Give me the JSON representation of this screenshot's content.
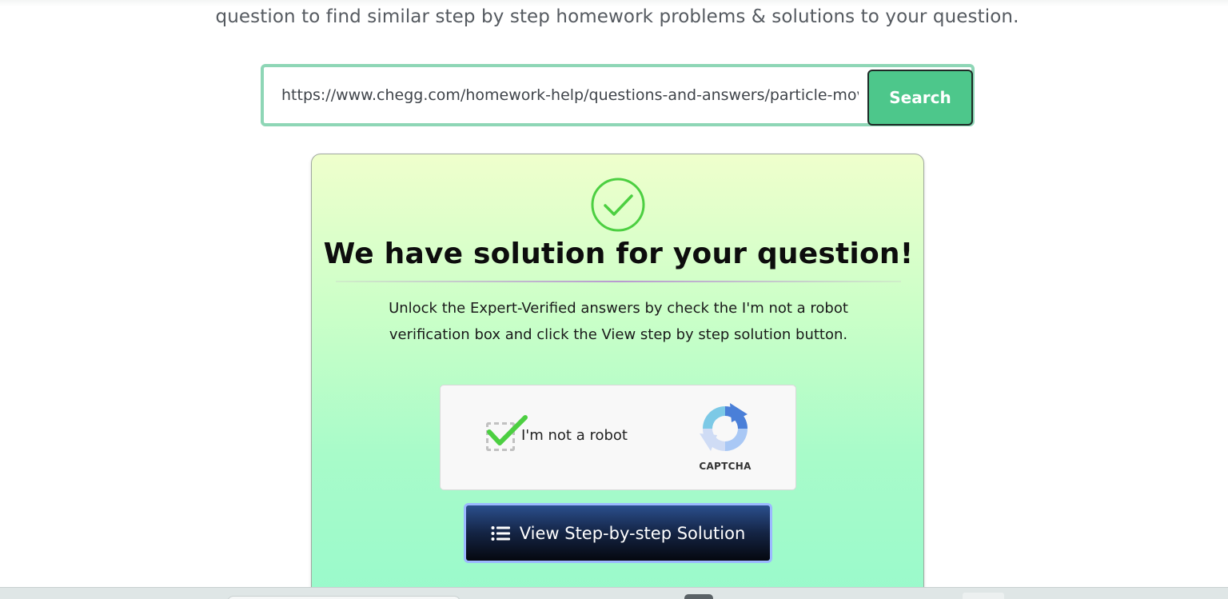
{
  "header": {
    "intro_text": "question to find similar step by step homework problems & solutions to your question."
  },
  "search": {
    "value": "https://www.chegg.com/homework-help/questions-and-answers/particle-movi",
    "button_label": "Search"
  },
  "result_card": {
    "title": "We have solution for your question!",
    "description": "Unlock the Expert-Verified answers by check the I'm not a robot verification box and click the View step by step solution button.",
    "captcha": {
      "checkbox_label": "I'm not a robot",
      "checked": true,
      "brand_label": "CAPTCHA"
    },
    "solution_button_label": "View Step-by-step Solution"
  },
  "icons": {
    "success": "check-circle-icon",
    "captcha_logo": "recaptcha-icon",
    "solution_button": "list-icon"
  },
  "colors": {
    "accent_green": "#4dc78b",
    "search_border": "#8ed6b6",
    "check_green": "#4ccf41",
    "button_navy": "#142444"
  }
}
